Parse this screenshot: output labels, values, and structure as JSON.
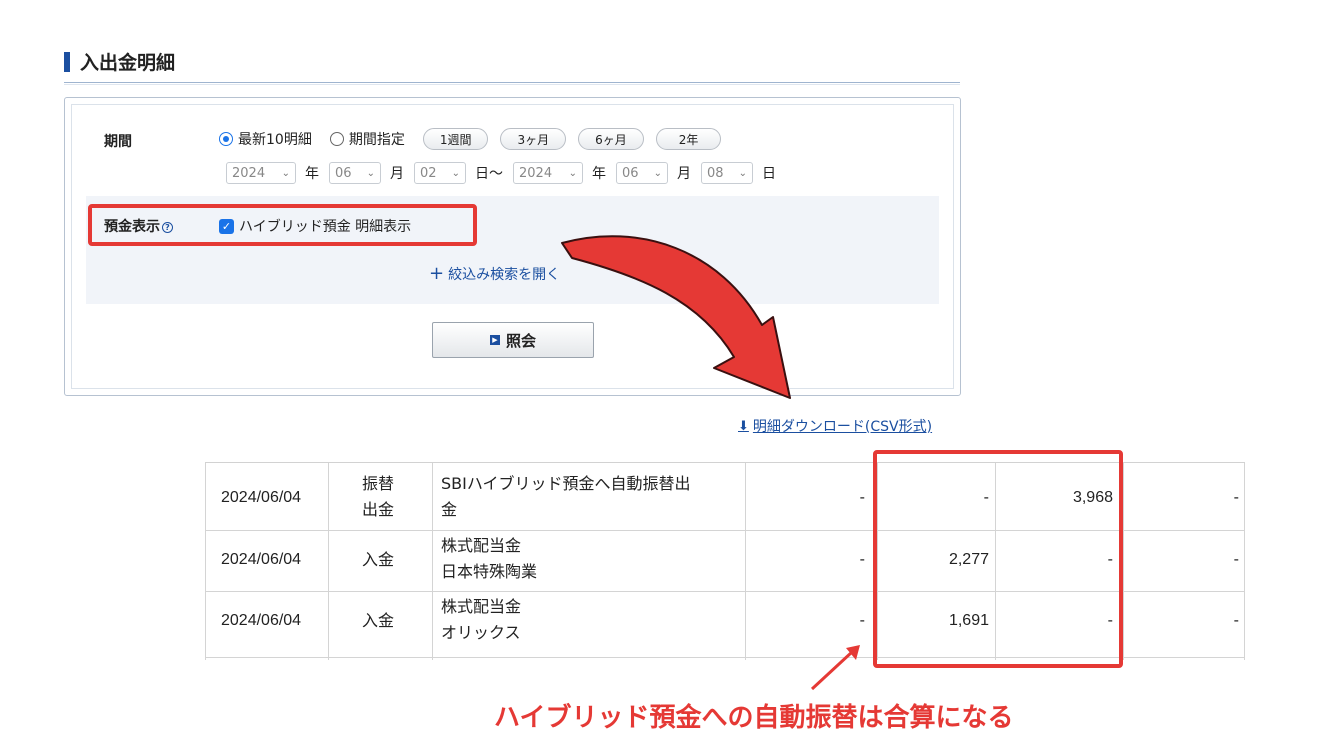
{
  "section": {
    "title": "入出金明細"
  },
  "period": {
    "label": "期間",
    "radio_latest": "最新10明細",
    "radio_range": "期間指定",
    "quick_buttons": [
      "1週間",
      "3ヶ月",
      "6ヶ月",
      "2年"
    ],
    "from": {
      "year": "2024",
      "month": "06",
      "day": "02"
    },
    "to": {
      "year": "2024",
      "month": "06",
      "day": "08"
    },
    "unit_year": "年",
    "unit_month": "月",
    "unit_day_from": "日〜",
    "unit_day_to": "日"
  },
  "deposit": {
    "label": "預金表示",
    "help_glyph": "?",
    "checkbox_label": "ハイブリッド預金 明細表示",
    "checked": true
  },
  "expand_search": "絞込み検索を開く",
  "inquiry_button": "照会",
  "download_link": "明細ダウンロード(CSV形式)",
  "table": {
    "rows": [
      {
        "date": "2024/06/04",
        "type": "振替\n出金",
        "desc": "SBIハイブリッド預金へ自動振替出\n金",
        "c1": "-",
        "c2": "-",
        "c3": "3,968",
        "c4": "-"
      },
      {
        "date": "2024/06/04",
        "type": "入金",
        "desc": "株式配当金\n日本特殊陶業",
        "c1": "-",
        "c2": "2,277",
        "c3": "-",
        "c4": "-"
      },
      {
        "date": "2024/06/04",
        "type": "入金",
        "desc": "株式配当金\nオリックス",
        "c1": "-",
        "c2": "1,691",
        "c3": "-",
        "c4": "-"
      }
    ]
  },
  "annotation": {
    "caption": "ハイブリッド預金への自動振替は合算になる",
    "color": "#e53935"
  },
  "colors": {
    "accent": "#1b4fa0",
    "checkbox": "#1a73e8"
  }
}
